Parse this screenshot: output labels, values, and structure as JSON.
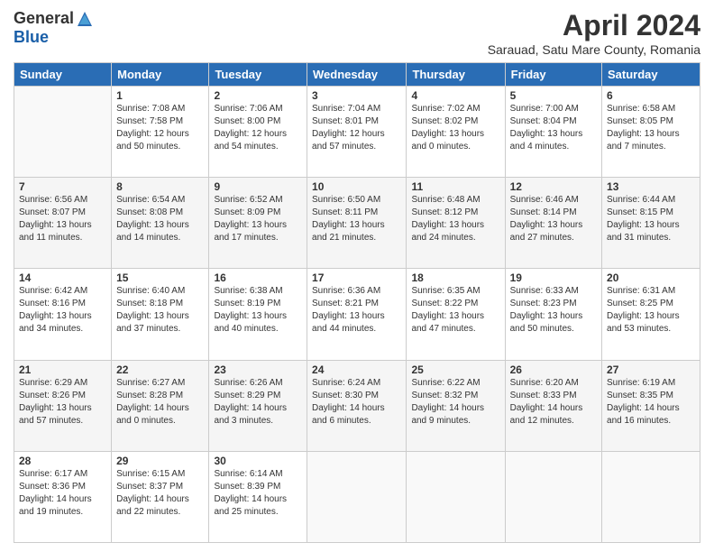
{
  "logo": {
    "general": "General",
    "blue": "Blue"
  },
  "title": "April 2024",
  "subtitle": "Sarauad, Satu Mare County, Romania",
  "days_of_week": [
    "Sunday",
    "Monday",
    "Tuesday",
    "Wednesday",
    "Thursday",
    "Friday",
    "Saturday"
  ],
  "weeks": [
    [
      {
        "day": "",
        "info": ""
      },
      {
        "day": "1",
        "info": "Sunrise: 7:08 AM\nSunset: 7:58 PM\nDaylight: 12 hours\nand 50 minutes."
      },
      {
        "day": "2",
        "info": "Sunrise: 7:06 AM\nSunset: 8:00 PM\nDaylight: 12 hours\nand 54 minutes."
      },
      {
        "day": "3",
        "info": "Sunrise: 7:04 AM\nSunset: 8:01 PM\nDaylight: 12 hours\nand 57 minutes."
      },
      {
        "day": "4",
        "info": "Sunrise: 7:02 AM\nSunset: 8:02 PM\nDaylight: 13 hours\nand 0 minutes."
      },
      {
        "day": "5",
        "info": "Sunrise: 7:00 AM\nSunset: 8:04 PM\nDaylight: 13 hours\nand 4 minutes."
      },
      {
        "day": "6",
        "info": "Sunrise: 6:58 AM\nSunset: 8:05 PM\nDaylight: 13 hours\nand 7 minutes."
      }
    ],
    [
      {
        "day": "7",
        "info": "Sunrise: 6:56 AM\nSunset: 8:07 PM\nDaylight: 13 hours\nand 11 minutes."
      },
      {
        "day": "8",
        "info": "Sunrise: 6:54 AM\nSunset: 8:08 PM\nDaylight: 13 hours\nand 14 minutes."
      },
      {
        "day": "9",
        "info": "Sunrise: 6:52 AM\nSunset: 8:09 PM\nDaylight: 13 hours\nand 17 minutes."
      },
      {
        "day": "10",
        "info": "Sunrise: 6:50 AM\nSunset: 8:11 PM\nDaylight: 13 hours\nand 21 minutes."
      },
      {
        "day": "11",
        "info": "Sunrise: 6:48 AM\nSunset: 8:12 PM\nDaylight: 13 hours\nand 24 minutes."
      },
      {
        "day": "12",
        "info": "Sunrise: 6:46 AM\nSunset: 8:14 PM\nDaylight: 13 hours\nand 27 minutes."
      },
      {
        "day": "13",
        "info": "Sunrise: 6:44 AM\nSunset: 8:15 PM\nDaylight: 13 hours\nand 31 minutes."
      }
    ],
    [
      {
        "day": "14",
        "info": "Sunrise: 6:42 AM\nSunset: 8:16 PM\nDaylight: 13 hours\nand 34 minutes."
      },
      {
        "day": "15",
        "info": "Sunrise: 6:40 AM\nSunset: 8:18 PM\nDaylight: 13 hours\nand 37 minutes."
      },
      {
        "day": "16",
        "info": "Sunrise: 6:38 AM\nSunset: 8:19 PM\nDaylight: 13 hours\nand 40 minutes."
      },
      {
        "day": "17",
        "info": "Sunrise: 6:36 AM\nSunset: 8:21 PM\nDaylight: 13 hours\nand 44 minutes."
      },
      {
        "day": "18",
        "info": "Sunrise: 6:35 AM\nSunset: 8:22 PM\nDaylight: 13 hours\nand 47 minutes."
      },
      {
        "day": "19",
        "info": "Sunrise: 6:33 AM\nSunset: 8:23 PM\nDaylight: 13 hours\nand 50 minutes."
      },
      {
        "day": "20",
        "info": "Sunrise: 6:31 AM\nSunset: 8:25 PM\nDaylight: 13 hours\nand 53 minutes."
      }
    ],
    [
      {
        "day": "21",
        "info": "Sunrise: 6:29 AM\nSunset: 8:26 PM\nDaylight: 13 hours\nand 57 minutes."
      },
      {
        "day": "22",
        "info": "Sunrise: 6:27 AM\nSunset: 8:28 PM\nDaylight: 14 hours\nand 0 minutes."
      },
      {
        "day": "23",
        "info": "Sunrise: 6:26 AM\nSunset: 8:29 PM\nDaylight: 14 hours\nand 3 minutes."
      },
      {
        "day": "24",
        "info": "Sunrise: 6:24 AM\nSunset: 8:30 PM\nDaylight: 14 hours\nand 6 minutes."
      },
      {
        "day": "25",
        "info": "Sunrise: 6:22 AM\nSunset: 8:32 PM\nDaylight: 14 hours\nand 9 minutes."
      },
      {
        "day": "26",
        "info": "Sunrise: 6:20 AM\nSunset: 8:33 PM\nDaylight: 14 hours\nand 12 minutes."
      },
      {
        "day": "27",
        "info": "Sunrise: 6:19 AM\nSunset: 8:35 PM\nDaylight: 14 hours\nand 16 minutes."
      }
    ],
    [
      {
        "day": "28",
        "info": "Sunrise: 6:17 AM\nSunset: 8:36 PM\nDaylight: 14 hours\nand 19 minutes."
      },
      {
        "day": "29",
        "info": "Sunrise: 6:15 AM\nSunset: 8:37 PM\nDaylight: 14 hours\nand 22 minutes."
      },
      {
        "day": "30",
        "info": "Sunrise: 6:14 AM\nSunset: 8:39 PM\nDaylight: 14 hours\nand 25 minutes."
      },
      {
        "day": "",
        "info": ""
      },
      {
        "day": "",
        "info": ""
      },
      {
        "day": "",
        "info": ""
      },
      {
        "day": "",
        "info": ""
      }
    ]
  ]
}
